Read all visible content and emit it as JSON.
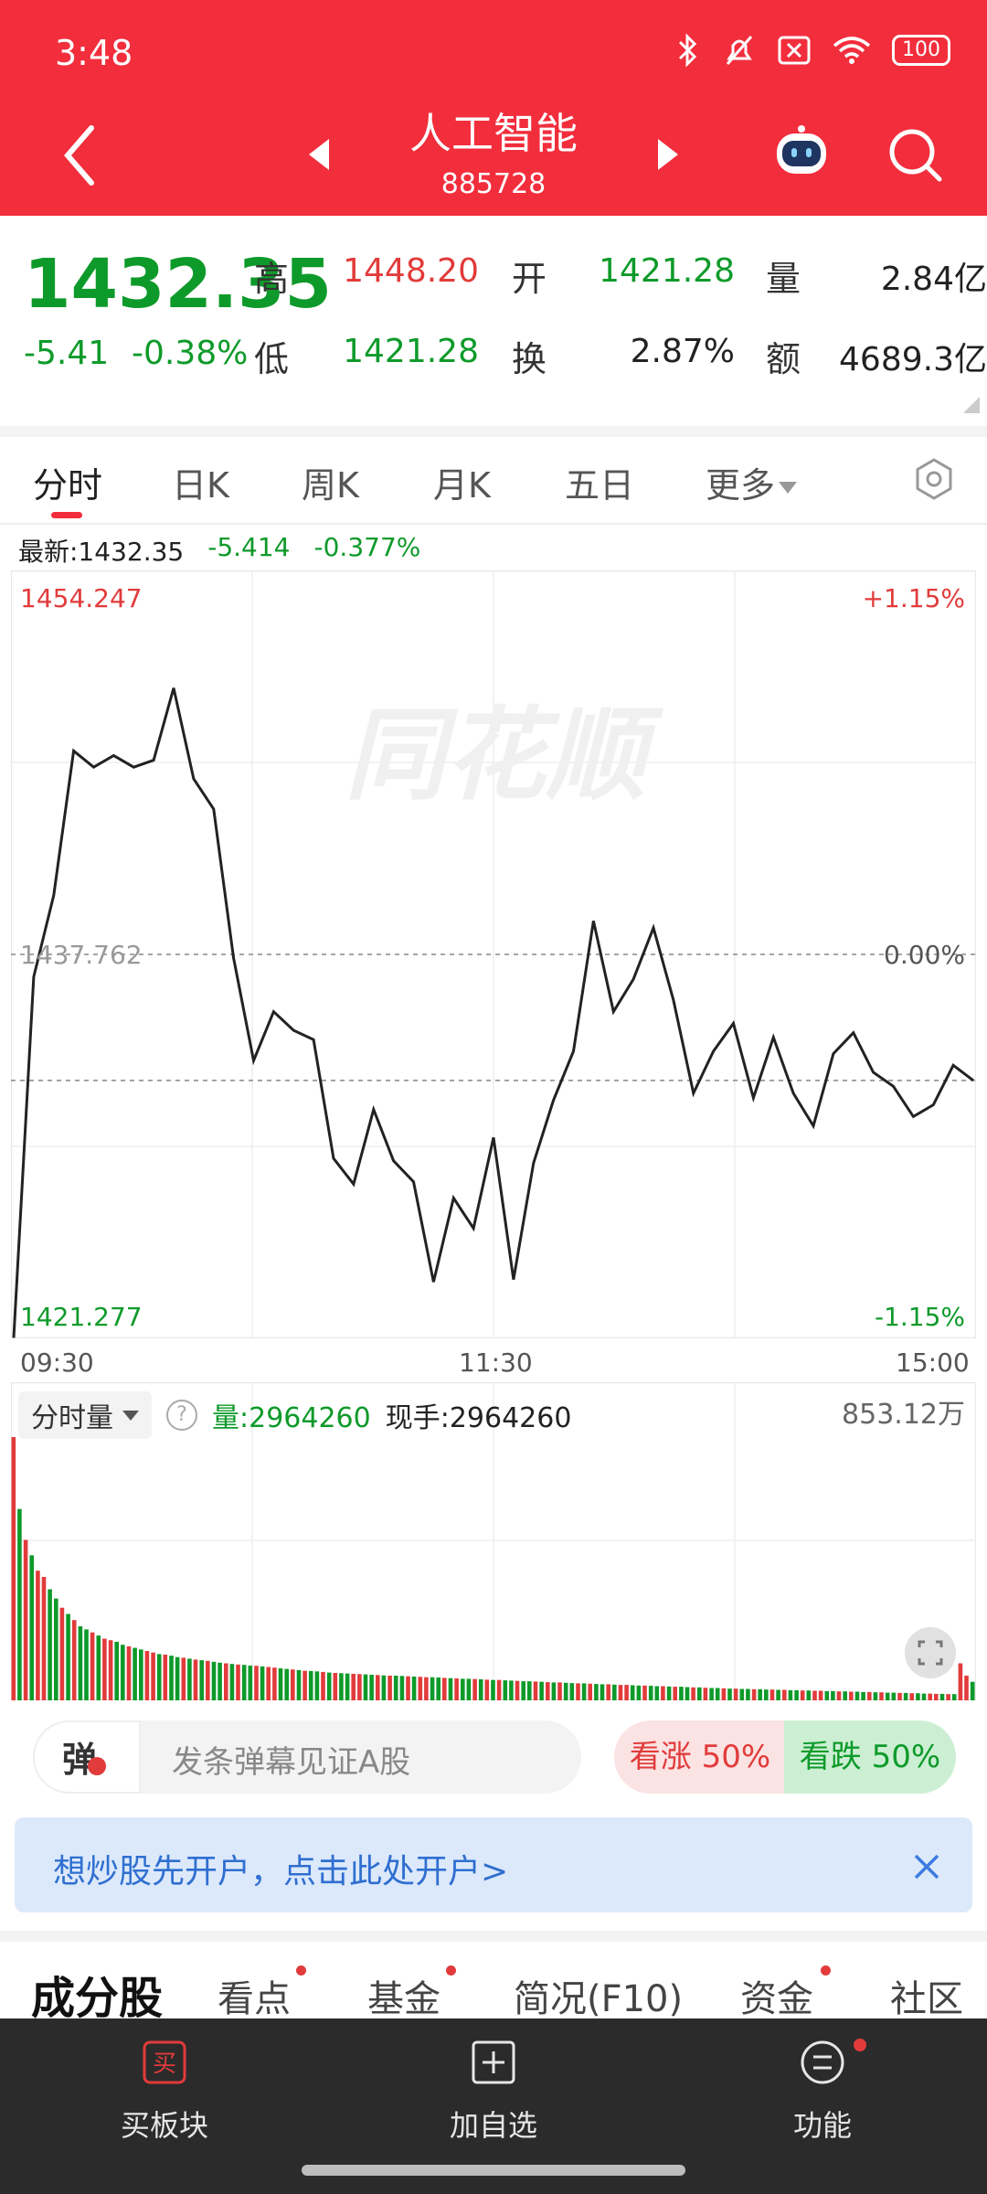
{
  "status_bar": {
    "time": "3:48",
    "battery": "100"
  },
  "header": {
    "title": "人工智能",
    "code": "885728"
  },
  "quote": {
    "price": "1432.35",
    "change": "-5.41",
    "change_pct": "-0.38%",
    "high_label": "高",
    "high": "1448.20",
    "open_label": "开",
    "open": "1421.28",
    "volume_label": "量",
    "volume": "2.84亿",
    "low_label": "低",
    "low": "1421.28",
    "turnover_label": "换",
    "turnover": "2.87%",
    "amount_label": "额",
    "amount": "4689.3亿"
  },
  "chart_tabs": [
    "分时",
    "日K",
    "周K",
    "月K",
    "五日",
    "更多"
  ],
  "latest": {
    "label": "最新:1432.35",
    "change": "-5.414",
    "change_pct": "-0.377%"
  },
  "chart_labels": {
    "top_price": "1454.247",
    "top_pct": "+1.15%",
    "mid_price": "1437.762",
    "mid_pct": "0.00%",
    "bottom_price": "1421.277",
    "bottom_pct": "-1.15%",
    "watermark": "同花顺"
  },
  "time_labels": [
    "09:30",
    "11:30",
    "15:00"
  ],
  "volume_header": {
    "selector": "分时量",
    "qty": "量:2964260",
    "now_hand": "现手:2964260",
    "max": "853.12万"
  },
  "danmu": {
    "icon_char": "弹",
    "placeholder": "发条弹幕见证A股"
  },
  "vote": {
    "up": "看涨 50%",
    "down": "看跌 50%"
  },
  "banner": {
    "text": "想炒股先开户，点击此处开户>"
  },
  "section_tabs": [
    "成分股",
    "看点",
    "基金",
    "简况(F10)",
    "资金",
    "社区"
  ],
  "bottom_nav": [
    {
      "label": "买板块"
    },
    {
      "label": "加自选"
    },
    {
      "label": "功能"
    }
  ],
  "colors": {
    "brand_red": "#f22d3c",
    "up": "#e23b3b",
    "down": "#0e9a2a"
  },
  "chart_data": {
    "type": "line",
    "ylim": [
      1421.277,
      1454.247
    ],
    "prev_close": 1437.762,
    "x": [
      "09:30",
      "09:35",
      "09:40",
      "09:45",
      "09:50",
      "09:55",
      "10:00",
      "10:05",
      "10:10",
      "10:15",
      "10:20",
      "10:25",
      "10:30",
      "10:35",
      "10:40",
      "10:45",
      "10:50",
      "10:55",
      "11:00",
      "11:05",
      "11:10",
      "11:15",
      "11:20",
      "11:25",
      "11:30",
      "13:05",
      "13:10",
      "13:15",
      "13:20",
      "13:25",
      "13:30",
      "13:35",
      "13:40",
      "13:45",
      "13:50",
      "13:55",
      "14:00",
      "14:05",
      "14:10",
      "14:15",
      "14:20",
      "14:25",
      "14:30",
      "14:35",
      "14:40",
      "14:45",
      "14:50",
      "14:55",
      "15:00"
    ],
    "series": [
      {
        "values": [
          1421.3,
          1436.8,
          1440.3,
          1446.5,
          1445.8,
          1446.3,
          1445.8,
          1446.1,
          1449.2,
          1445.3,
          1444.0,
          1437.6,
          1433.2,
          1435.3,
          1434.5,
          1434.1,
          1429.0,
          1427.9,
          1431.1,
          1428.9,
          1428.0,
          1423.7,
          1427.3,
          1426.0,
          1429.9,
          1423.8,
          1428.8,
          1431.5,
          1433.6,
          1439.2,
          1435.3,
          1436.7,
          1438.9,
          1435.8,
          1431.8,
          1433.6,
          1434.8,
          1431.6,
          1434.2,
          1431.8,
          1430.4,
          1433.5,
          1434.4,
          1432.7,
          1432.1,
          1430.8,
          1431.3,
          1433.0,
          1432.35
        ]
      }
    ]
  },
  "volume_data": {
    "type": "bar",
    "max": 853.12,
    "unit": "万",
    "values": [
      853,
      620,
      520,
      470,
      420,
      400,
      360,
      330,
      300,
      280,
      260,
      240,
      230,
      220,
      210,
      200,
      195,
      190,
      180,
      175,
      170,
      165,
      160,
      155,
      150,
      148,
      145,
      140,
      138,
      135,
      132,
      130,
      128,
      125,
      122,
      120,
      118,
      116,
      115,
      113,
      112,
      110,
      108,
      106,
      104,
      102,
      100,
      98,
      96,
      95,
      94,
      92,
      90,
      89,
      88,
      87,
      86,
      85,
      84,
      83,
      82,
      81,
      80,
      80,
      79,
      78,
      77,
      76,
      75,
      75,
      74,
      73,
      72,
      71,
      70,
      70,
      69,
      68,
      67,
      66,
      66,
      65,
      64,
      63,
      62,
      62,
      61,
      60,
      59,
      58,
      58,
      57,
      56,
      55,
      55,
      54,
      53,
      52,
      52,
      51,
      50,
      50,
      49,
      48,
      48,
      47,
      46,
      46,
      45,
      44,
      44,
      43,
      42,
      42,
      41,
      40,
      40,
      39,
      38,
      38,
      37,
      37,
      36,
      36,
      35,
      35,
      34,
      34,
      33,
      33,
      32,
      32,
      31,
      31,
      30,
      30,
      29,
      29,
      28,
      28,
      27,
      27,
      26,
      26,
      25,
      25,
      24,
      24,
      23,
      23,
      22,
      22,
      21,
      21,
      20,
      20,
      120,
      80,
      60
    ],
    "colors": [
      "r",
      "g",
      "r",
      "g",
      "r",
      "r",
      "g",
      "g",
      "r",
      "g",
      "r",
      "g",
      "g",
      "r",
      "g",
      "r",
      "r",
      "g",
      "g",
      "r",
      "g",
      "g",
      "r",
      "r",
      "g",
      "r",
      "g",
      "g",
      "r",
      "g",
      "r",
      "g",
      "r",
      "g",
      "g",
      "r",
      "g",
      "r",
      "g",
      "g",
      "r",
      "g",
      "r",
      "r",
      "g",
      "g",
      "r",
      "g",
      "r",
      "g",
      "g",
      "r",
      "g",
      "r",
      "g",
      "g",
      "r",
      "r",
      "g",
      "g",
      "r",
      "g",
      "r",
      "g",
      "g",
      "r",
      "g",
      "r",
      "r",
      "g",
      "g",
      "r",
      "g",
      "r",
      "g",
      "g",
      "r",
      "g",
      "r",
      "g",
      "r",
      "g",
      "g",
      "r",
      "g",
      "g",
      "r",
      "g",
      "r",
      "g",
      "r",
      "g",
      "g",
      "r",
      "g",
      "r",
      "g",
      "g",
      "r",
      "g",
      "r",
      "r",
      "g",
      "g",
      "r",
      "g",
      "g",
      "r",
      "g",
      "r",
      "g",
      "g",
      "r",
      "g",
      "r",
      "g",
      "g",
      "r",
      "g",
      "r",
      "g",
      "g",
      "r",
      "g",
      "g",
      "r",
      "g",
      "r",
      "g",
      "g",
      "r",
      "g",
      "r",
      "r",
      "g",
      "g",
      "r",
      "g",
      "r",
      "g",
      "g",
      "r",
      "g",
      "r",
      "g",
      "g",
      "r",
      "g",
      "r",
      "g",
      "g",
      "r",
      "r",
      "g",
      "r",
      "g",
      "r",
      "r",
      "g"
    ]
  }
}
